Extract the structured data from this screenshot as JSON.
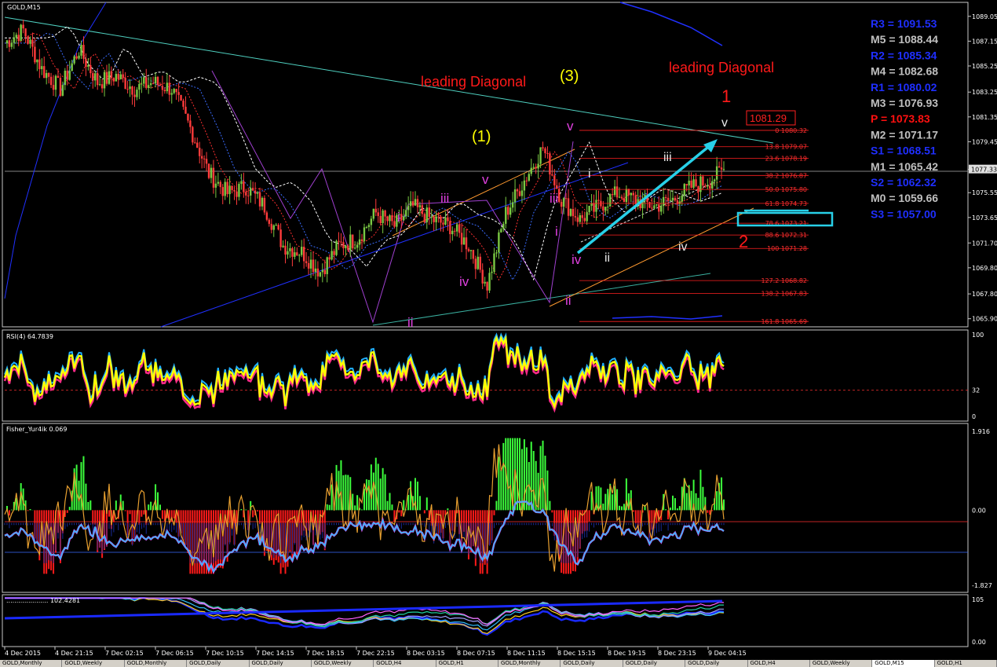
{
  "window": {
    "title": "GOLD,M15"
  },
  "indicators": {
    "rsi_label": "RSI(4) 64.7839",
    "fisher_label": "Fisher_Yur4ik 0.069",
    "bottom_label": "..................... 102.4281"
  },
  "annotations": {
    "ld_left": "leading Diagonal",
    "ld_right": "leading Diagonal",
    "wave3": "(3)",
    "wave1_paren": "(1)",
    "red1": "1",
    "red2": "2",
    "w_i": "i",
    "w_ii": "ii",
    "w_iii": "iii",
    "w_iv": "iv",
    "w_v": "v",
    "w_i_b": "i",
    "w_ii_b": "ii",
    "w_iii_b": "iii",
    "w_iv_b": "iv",
    "w_v_b": "v",
    "s_i": "i",
    "s_ii": "ii",
    "s_iii": "iii",
    "s_iv": "iv",
    "s_v": "v",
    "ii_mid": "ii",
    "target_box": "1081.29"
  },
  "pivots": [
    {
      "label": "R3 = 1091.53",
      "color": "#1f2fff"
    },
    {
      "label": "M5 = 1088.44",
      "color": "#c0c0c0"
    },
    {
      "label": "R2 = 1085.34",
      "color": "#1f2fff"
    },
    {
      "label": "M4 = 1082.68",
      "color": "#c0c0c0"
    },
    {
      "label": "R1 = 1080.02",
      "color": "#1f2fff"
    },
    {
      "label": "M3 = 1076.93",
      "color": "#c0c0c0"
    },
    {
      "label": "P = 1073.83",
      "color": "#ff1010"
    },
    {
      "label": "M2 = 1071.17",
      "color": "#c0c0c0"
    },
    {
      "label": "S1 = 1068.51",
      "color": "#1f2fff"
    },
    {
      "label": "M1 = 1065.42",
      "color": "#c0c0c0"
    },
    {
      "label": "S2 = 1062.32",
      "color": "#1f2fff"
    },
    {
      "label": "M0 = 1059.66",
      "color": "#c0c0c0"
    },
    {
      "label": "S3 = 1057.00",
      "color": "#1f2fff"
    }
  ],
  "fib_levels": [
    {
      "label": "0 1080.32",
      "price": 1080.32
    },
    {
      "label": "13.8 1079.07",
      "price": 1079.07
    },
    {
      "label": "23.6 1078.19",
      "price": 1078.19
    },
    {
      "label": "38.2 1076.87",
      "price": 1076.87
    },
    {
      "label": "50.0 1075.80",
      "price": 1075.8
    },
    {
      "label": "61.8 1074.73",
      "price": 1074.73
    },
    {
      "label": "78.6 1073.21",
      "price": 1073.21
    },
    {
      "label": "88.6 1072.31",
      "price": 1072.31
    },
    {
      "label": "100 1071.28",
      "price": 1071.28
    },
    {
      "label": "127.2 1068.82",
      "price": 1068.82
    },
    {
      "label": "138.2 1067.83",
      "price": 1067.83
    },
    {
      "label": "161.8 1065.69",
      "price": 1065.69
    }
  ],
  "chart_data": {
    "type": "candlestick",
    "symbol": "GOLD",
    "timeframe": "M15",
    "current_price": "1077.33",
    "price_ticks": [
      "1089.05",
      "1087.15",
      "1085.25",
      "1083.25",
      "1081.35",
      "1079.45",
      "1077.33",
      "1075.55",
      "1073.65",
      "1071.70",
      "1069.80",
      "1067.80",
      "1065.90"
    ],
    "price_tick_values": [
      1089.05,
      1087.15,
      1085.25,
      1083.25,
      1081.35,
      1079.45,
      1077.33,
      1075.55,
      1073.65,
      1071.7,
      1069.8,
      1067.8,
      1065.9
    ],
    "ylim": [
      1065.4,
      1090.0
    ],
    "time_ticks": [
      "4 Dec 2015",
      "4 Dec 21:15",
      "7 Dec 02:15",
      "7 Dec 06:15",
      "7 Dec 10:15",
      "7 Dec 14:15",
      "7 Dec 18:15",
      "7 Dec 22:15",
      "8 Dec 03:15",
      "8 Dec 07:15",
      "8 Dec 11:15",
      "8 Dec 15:15",
      "8 Dec 19:15",
      "8 Dec 23:15",
      "9 Dec 04:15"
    ],
    "close_path": [
      [
        0,
        1087.0
      ],
      [
        8,
        1088.0
      ],
      [
        16,
        1085.0
      ],
      [
        24,
        1083.5
      ],
      [
        32,
        1086.5
      ],
      [
        40,
        1084.0
      ],
      [
        48,
        1084.5
      ],
      [
        56,
        1083.5
      ],
      [
        64,
        1084.0
      ],
      [
        72,
        1083.5
      ],
      [
        80,
        1080.5
      ],
      [
        88,
        1077.0
      ],
      [
        96,
        1075.5
      ],
      [
        104,
        1076.0
      ],
      [
        112,
        1074.5
      ],
      [
        120,
        1071.5
      ],
      [
        128,
        1071.0
      ],
      [
        136,
        1069.5
      ],
      [
        144,
        1071.5
      ],
      [
        152,
        1072.0
      ],
      [
        160,
        1074.0
      ],
      [
        168,
        1073.0
      ],
      [
        176,
        1074.5
      ],
      [
        184,
        1073.5
      ],
      [
        192,
        1073.0
      ],
      [
        200,
        1071.5
      ],
      [
        208,
        1068.5
      ],
      [
        216,
        1074.0
      ],
      [
        224,
        1076.5
      ],
      [
        232,
        1079.0
      ],
      [
        240,
        1075.0
      ],
      [
        248,
        1073.5
      ],
      [
        256,
        1074.5
      ],
      [
        264,
        1075.5
      ],
      [
        272,
        1075.0
      ],
      [
        280,
        1074.5
      ],
      [
        288,
        1075.0
      ],
      [
        296,
        1076.0
      ],
      [
        304,
        1076.5
      ],
      [
        310,
        1077.3
      ]
    ],
    "rsi": {
      "label": "RSI(4) 64.7839",
      "levels": [
        "100",
        "32",
        "0"
      ],
      "ylim": [
        0,
        100
      ],
      "current": 64.7839
    },
    "fisher": {
      "label": "Fisher_Yur4ik 0.069",
      "levels": [
        "1.916",
        "0.00",
        "-1.827"
      ],
      "ylim": [
        -1.827,
        1.916
      ],
      "current": 0.069
    },
    "bottom": {
      "label": "..................... 102.4281",
      "levels": [
        "105",
        "0.00"
      ]
    }
  },
  "tabs": [
    "GOLD,Monthly",
    "GOLD,Weekly",
    "GOLD,Monthly",
    "GOLD,Daily",
    "GOLD,Daily",
    "GOLD,Weekly",
    "GOLD,H4",
    "GOLD,H1",
    "GOLD,Monthly",
    "GOLD,Daily",
    "GOLD,Daily",
    "GOLD,Daily",
    "GOLD,H4",
    "GOLD,Weekly",
    "GOLD,M15",
    "GOLD,H1"
  ]
}
